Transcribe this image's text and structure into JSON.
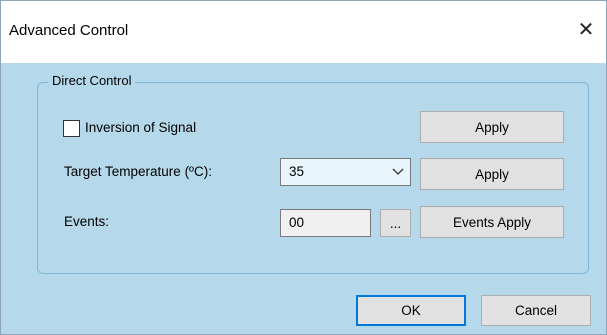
{
  "window": {
    "title": "Advanced Control",
    "close_glyph": "✕"
  },
  "group": {
    "label": "Direct Control"
  },
  "inversion": {
    "checkbox_label": "Inversion of Signal",
    "checked": false,
    "apply_label": "Apply"
  },
  "temperature": {
    "label": "Target Temperature (ºC):",
    "value": "35",
    "apply_label": "Apply"
  },
  "events": {
    "label": "Events:",
    "value": "00",
    "browse_label": "...",
    "apply_label": "Events Apply"
  },
  "footer": {
    "ok_label": "OK",
    "cancel_label": "Cancel"
  },
  "colors": {
    "background": "#b5d9ea",
    "button": "#e1e1e1",
    "focus_border": "#0078d7",
    "combo_bg": "#e8f6fc"
  }
}
